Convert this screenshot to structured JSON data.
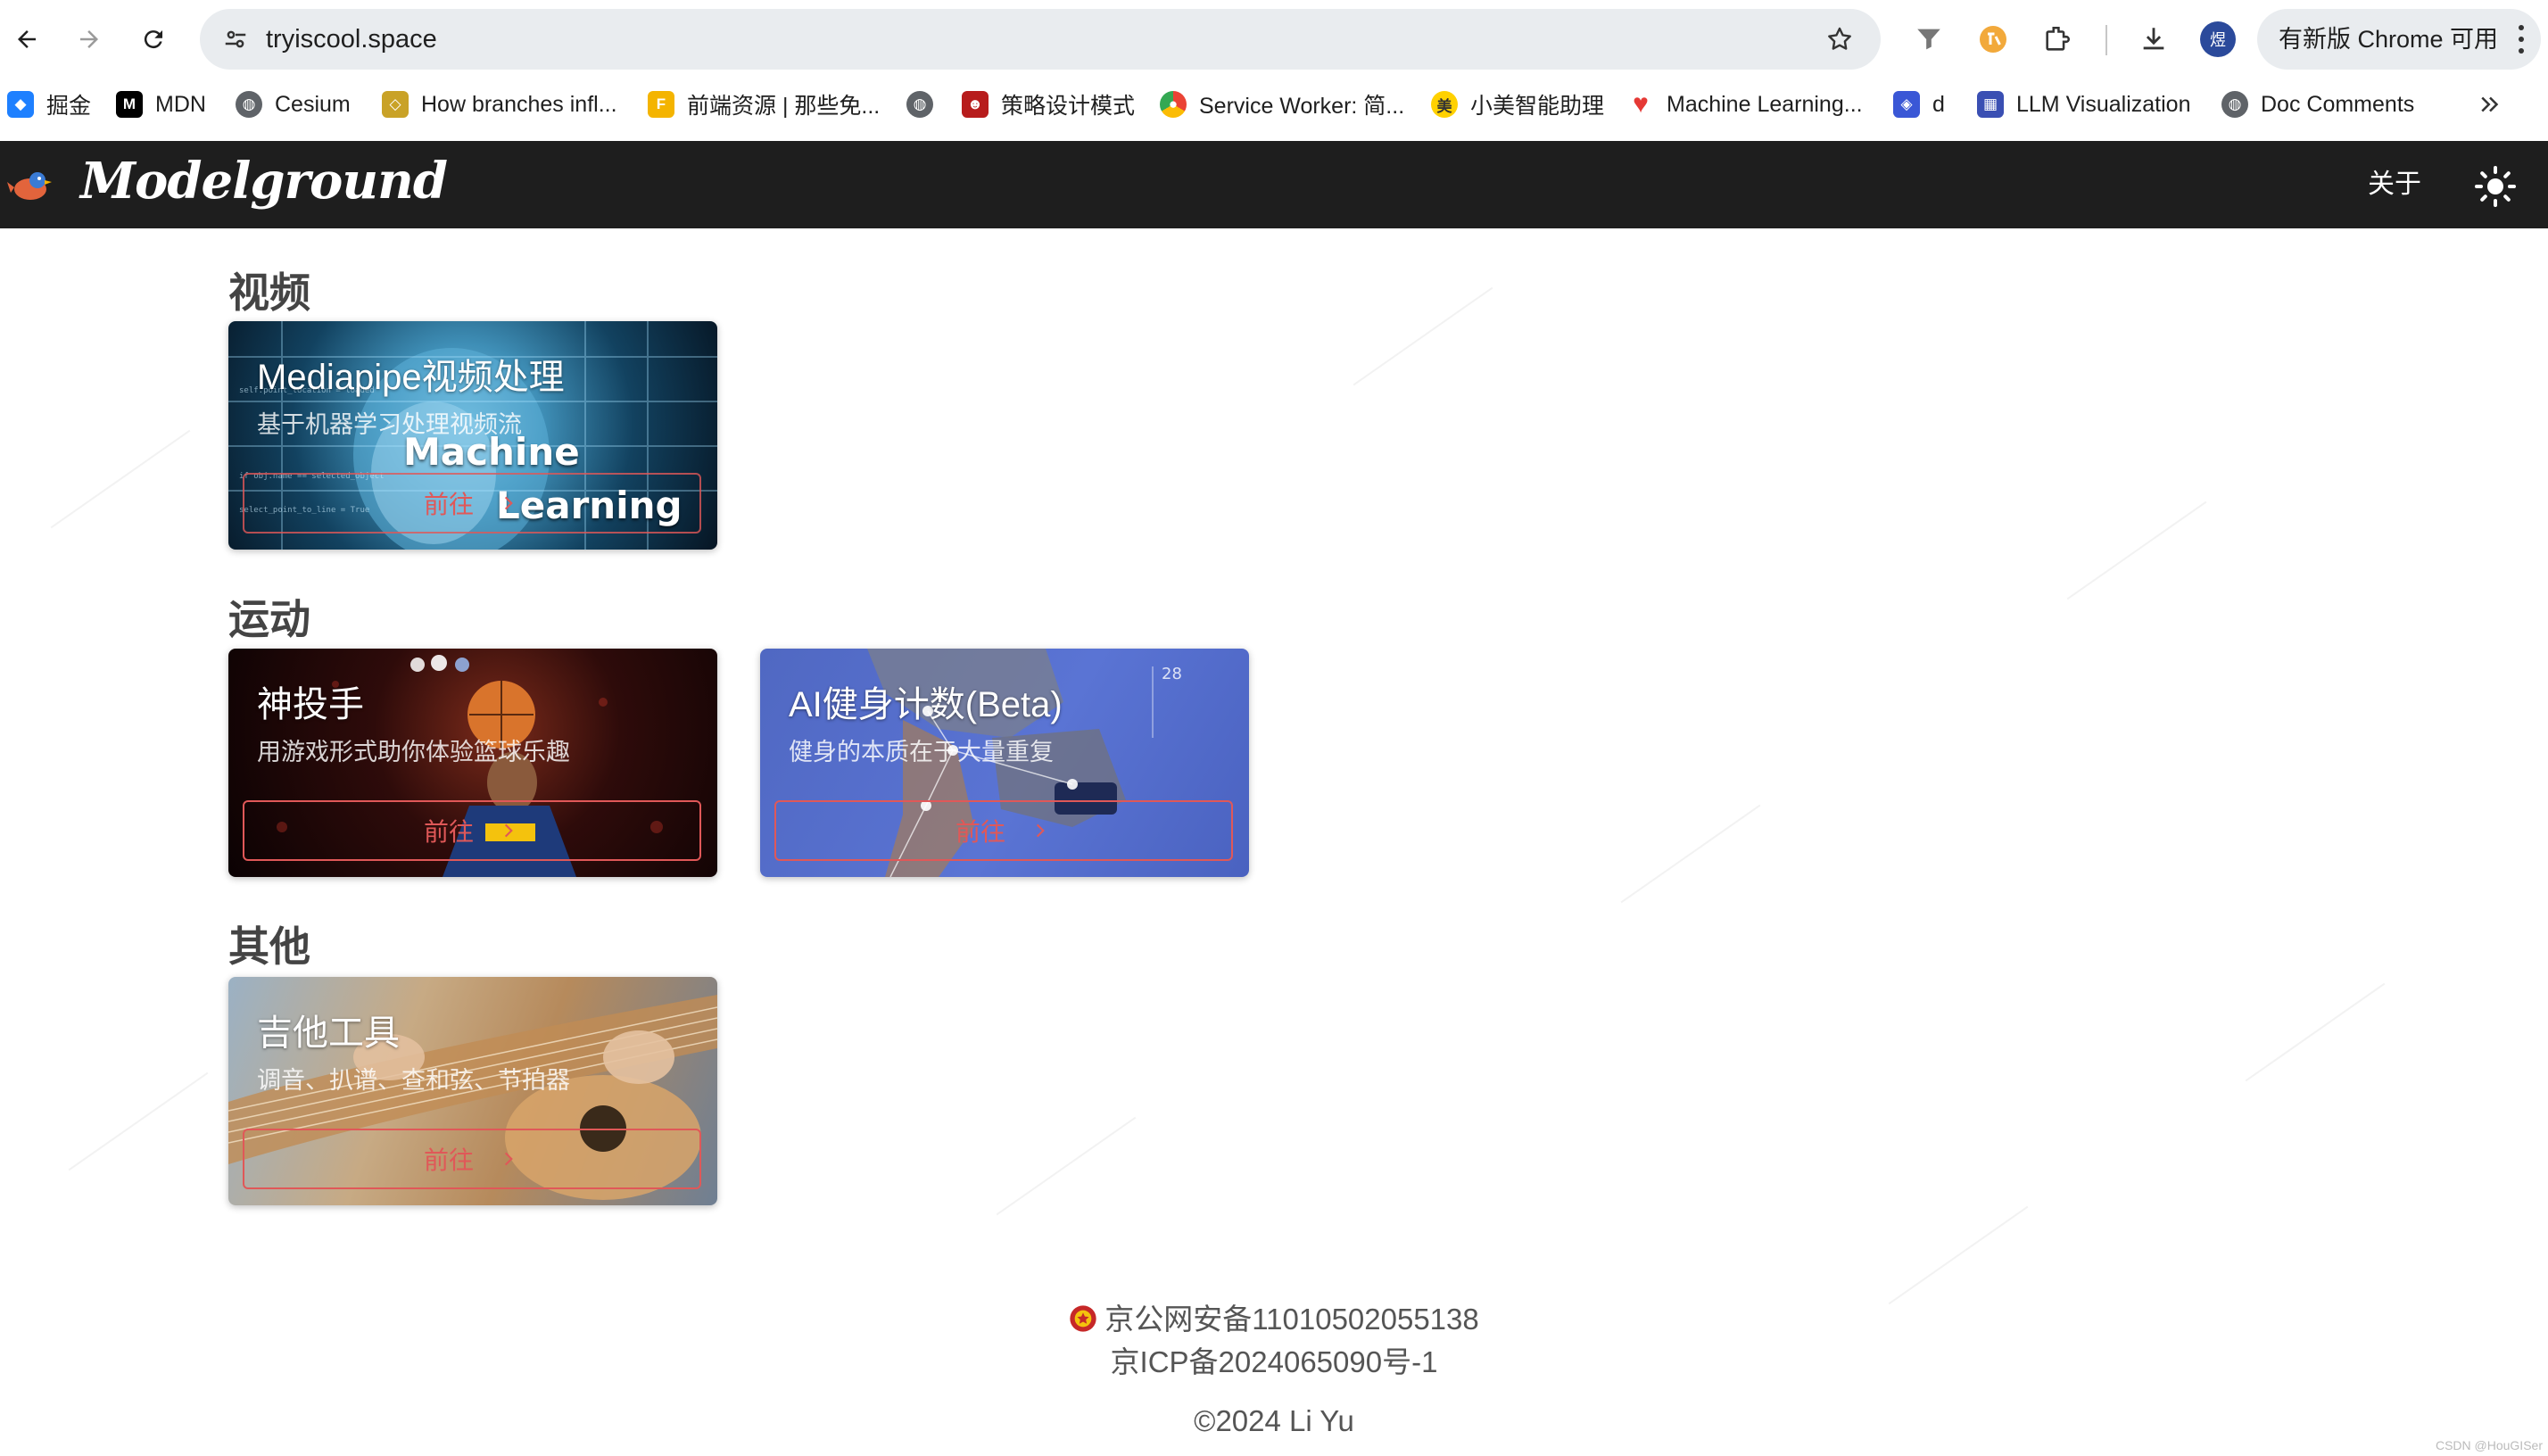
{
  "browser": {
    "url": "tryiscool.space",
    "update_label": "有新版 Chrome 可用",
    "profile_initial": "煜",
    "bookmarks": [
      {
        "label": "掘金",
        "icon": "juejin-icon",
        "color": "#1e80ff"
      },
      {
        "label": "MDN",
        "icon": "mdn-icon",
        "color": "#000000"
      },
      {
        "label": "Cesium",
        "icon": "globe-icon",
        "color": "#5f6368"
      },
      {
        "label": "How branches infl...",
        "icon": "diamond-icon",
        "color": "#c9a227"
      },
      {
        "label": "前端资源 | 那些免...",
        "icon": "bookmark-app-icon",
        "color": "#f4b400"
      },
      {
        "label": "",
        "icon": "globe-icon",
        "color": "#5f6368"
      },
      {
        "label": "策略设计模式",
        "icon": "red-mascot-icon",
        "color": "#b71c1c"
      },
      {
        "label": "Service Worker: 简...",
        "icon": "chrome-icon",
        "color": "#4285f4"
      },
      {
        "label": "小美智能助理",
        "icon": "meituan-icon",
        "color": "#ffd100"
      },
      {
        "label": "Machine Learning...",
        "icon": "heart-icon",
        "color": "#e53935"
      },
      {
        "label": "d",
        "icon": "tool-icon",
        "color": "#3a57d6"
      },
      {
        "label": "LLM Visualization",
        "icon": "grid-icon",
        "color": "#3a4fb3"
      },
      {
        "label": "Doc Comments",
        "icon": "globe-icon",
        "color": "#5f6368"
      }
    ]
  },
  "site": {
    "title": "Modelground",
    "about": "关于"
  },
  "sections": [
    {
      "title": "视频",
      "cards": [
        {
          "title": "Mediapipe视频处理",
          "subtitle": "基于机器学习处理视频流",
          "button": "前往",
          "overlay": [
            "Machine",
            "Learning"
          ]
        }
      ]
    },
    {
      "title": "运动",
      "cards": [
        {
          "title": "神投手",
          "subtitle": "用游戏形式助你体验篮球乐趣",
          "button": "前往"
        },
        {
          "title": "AI健身计数(Beta)",
          "subtitle": "健身的本质在于大量重复",
          "button": "前往"
        }
      ]
    },
    {
      "title": "其他",
      "cards": [
        {
          "title": "吉他工具",
          "subtitle": "调音、扒谱、查和弦、节拍器",
          "button": "前往"
        }
      ]
    }
  ],
  "footer": {
    "police_record": "京公网安备11010502055138",
    "icp": "京ICP备2024065090号-1",
    "copyright": "©2024 Li Yu"
  },
  "watermark": "CSDN @HouGISer"
}
